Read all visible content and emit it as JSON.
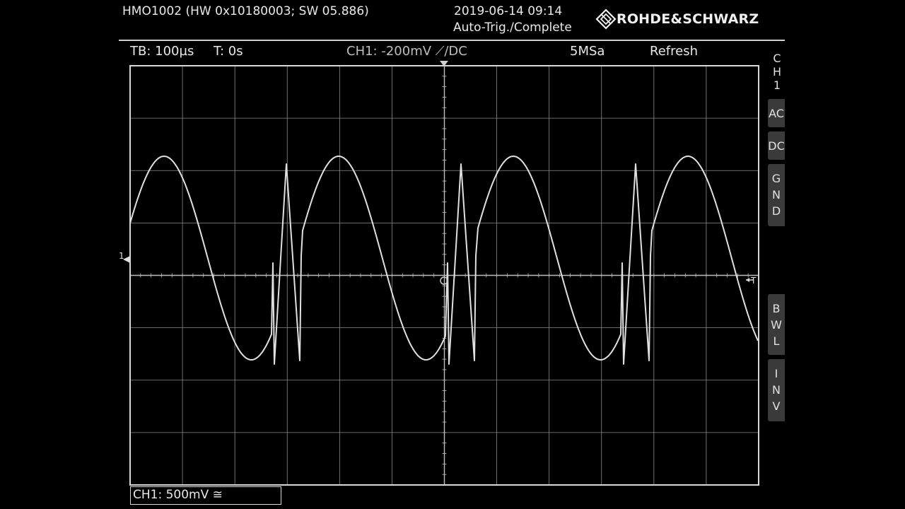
{
  "header": {
    "device_info": "HMO1002 (HW 0x10180003; SW 05.886)",
    "datetime": "2019-06-14 09:14",
    "trigger_status": "Auto-Trig./Complete",
    "brand": "ROHDE&SCHWARZ"
  },
  "status_bar": {
    "timebase": "TB: 100µs",
    "trigger_time": "T: 0s",
    "trigger_setting": "CH1: -200mV ⟋/DC",
    "sample_rate": "5MSa",
    "acquisition_mode": "Refresh"
  },
  "markers": {
    "channel_marker": "1",
    "trigger_marker": "T"
  },
  "side_menu": {
    "channel_label": [
      "C",
      "H",
      "1"
    ],
    "ac_button": "AC",
    "dc_button": "DC",
    "gnd_button": [
      "G",
      "N",
      "D"
    ],
    "bwl_button": [
      "B",
      "W",
      "L"
    ],
    "inv_button": [
      "I",
      "N",
      "V"
    ]
  },
  "channel_box": "CH1: 500mV ≅",
  "waveform": {
    "color": "#e0e0e0",
    "grid_color": "#8a8a8a"
  }
}
